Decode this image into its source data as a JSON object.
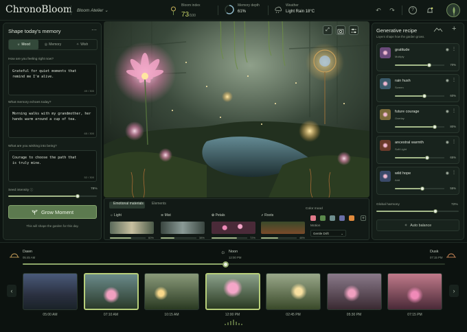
{
  "app": {
    "title": "ChronoBloom",
    "workspace": "Bloom Atelier"
  },
  "stats": {
    "bloom_label": "Bloom index",
    "bloom_value": "73",
    "bloom_total": "/100",
    "memory_label": "Memory depth",
    "memory_value": "61%",
    "memory_level": 0.61,
    "weather_label": "Weather",
    "weather_value": "Light Rain 18°C"
  },
  "left": {
    "title": "Shape today's memory",
    "tabs": [
      "Mood",
      "Memory",
      "Wish"
    ],
    "q1": "How are you feeling right now?",
    "a1": "Grateful for quiet moments that remind me I'm alive.",
    "a1_count": "49 / 300",
    "q2": "What memory echoes today?",
    "a2": "Morning walks with my grandmother, her hands warm around a cup of tea.",
    "a2_count": "65 / 300",
    "q3": "What are you wishing into being?",
    "a3": "Courage to choose the path that is truly mine.",
    "a3_count": "52 / 300",
    "seed_label": "Seed intensity",
    "seed_value": "78%",
    "seed_level": 0.78,
    "grow_label": "Grow Moment",
    "hint": "This will shape the garden for this day."
  },
  "materials": {
    "tabs": [
      "Emotional materials",
      "Elements"
    ],
    "items": [
      {
        "name": "Light",
        "pct": "60%",
        "level": 0.6
      },
      {
        "name": "Mist",
        "pct": "38%",
        "level": 0.38
      },
      {
        "name": "Petals",
        "pct": "72%",
        "level": 0.72
      },
      {
        "name": "Roots",
        "pct": "48%",
        "level": 0.48
      }
    ],
    "color_mood_label": "Color mood",
    "swatches": [
      "#e07a8a",
      "#5b8a4c",
      "#6f8f8f",
      "#6a6fa8",
      "#e08a3c"
    ],
    "motion_label": "Motion",
    "motion_value": "Gentle Drift"
  },
  "recipe": {
    "title": "Generative recipe",
    "subtitle": "Layers shape how the garden grows.",
    "layers": [
      {
        "name": "gratitude",
        "mode": "Multiply",
        "pct": "70%",
        "level": 0.7
      },
      {
        "name": "rain hush",
        "mode": "Screen",
        "pct": "60%",
        "level": 0.6
      },
      {
        "name": "future courage",
        "mode": "Overlay",
        "pct": "80%",
        "level": 0.8
      },
      {
        "name": "ancestral warmth",
        "mode": "Soft Light",
        "pct": "65%",
        "level": 0.65
      },
      {
        "name": "wild hope",
        "mode": "Add",
        "pct": "55%",
        "level": 0.55
      }
    ],
    "harmony_label": "Global harmony",
    "harmony_value": "72%",
    "harmony_level": 0.72,
    "auto_label": "Auto balance"
  },
  "timeline": {
    "dawn": "Dawn",
    "dawn_time": "05:45 AM",
    "noon": "Noon",
    "noon_time": "12:00 PM",
    "dusk": "Dusk",
    "dusk_time": "07:15 PM",
    "position": 0.48,
    "frames": [
      "05:00 AM",
      "07:10 AM",
      "10:15 AM",
      "12:00 PM",
      "02:45 PM",
      "05:30 PM",
      "07:15 PM"
    ]
  }
}
